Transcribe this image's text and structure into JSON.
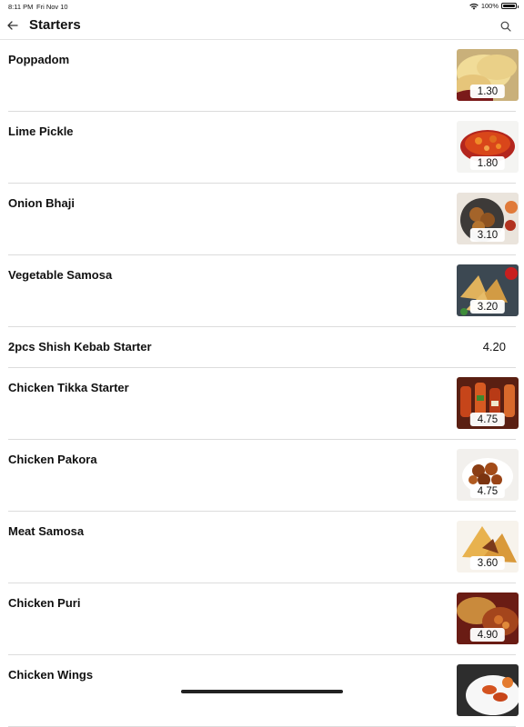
{
  "status": {
    "time": "8:11 PM",
    "date": "Fri Nov 10",
    "battery_text": "100%",
    "battery_level": 1.0
  },
  "header": {
    "back_icon": "arrow-left-icon",
    "title": "Starters",
    "search_icon": "search-icon"
  },
  "items": [
    {
      "name": "Poppadom",
      "price": "1.30",
      "has_image": true,
      "image": "poppadom"
    },
    {
      "name": "Lime Pickle",
      "price": "1.80",
      "has_image": true,
      "image": "pickle"
    },
    {
      "name": "Onion Bhaji",
      "price": "3.10",
      "has_image": true,
      "image": "bhaji"
    },
    {
      "name": "Vegetable Samosa",
      "price": "3.20",
      "has_image": true,
      "image": "samosa"
    },
    {
      "name": "2pcs Shish Kebab Starter",
      "price": "4.20",
      "has_image": false
    },
    {
      "name": "Chicken Tikka Starter",
      "price": "4.75",
      "has_image": true,
      "image": "tikka"
    },
    {
      "name": "Chicken Pakora",
      "price": "4.75",
      "has_image": true,
      "image": "pakora"
    },
    {
      "name": "Meat Samosa",
      "price": "3.60",
      "has_image": true,
      "image": "meatsamosa"
    },
    {
      "name": "Chicken Puri",
      "price": "4.90",
      "has_image": true,
      "image": "puri"
    },
    {
      "name": "Chicken Wings",
      "price": "",
      "has_image": true,
      "image": "wings"
    }
  ]
}
